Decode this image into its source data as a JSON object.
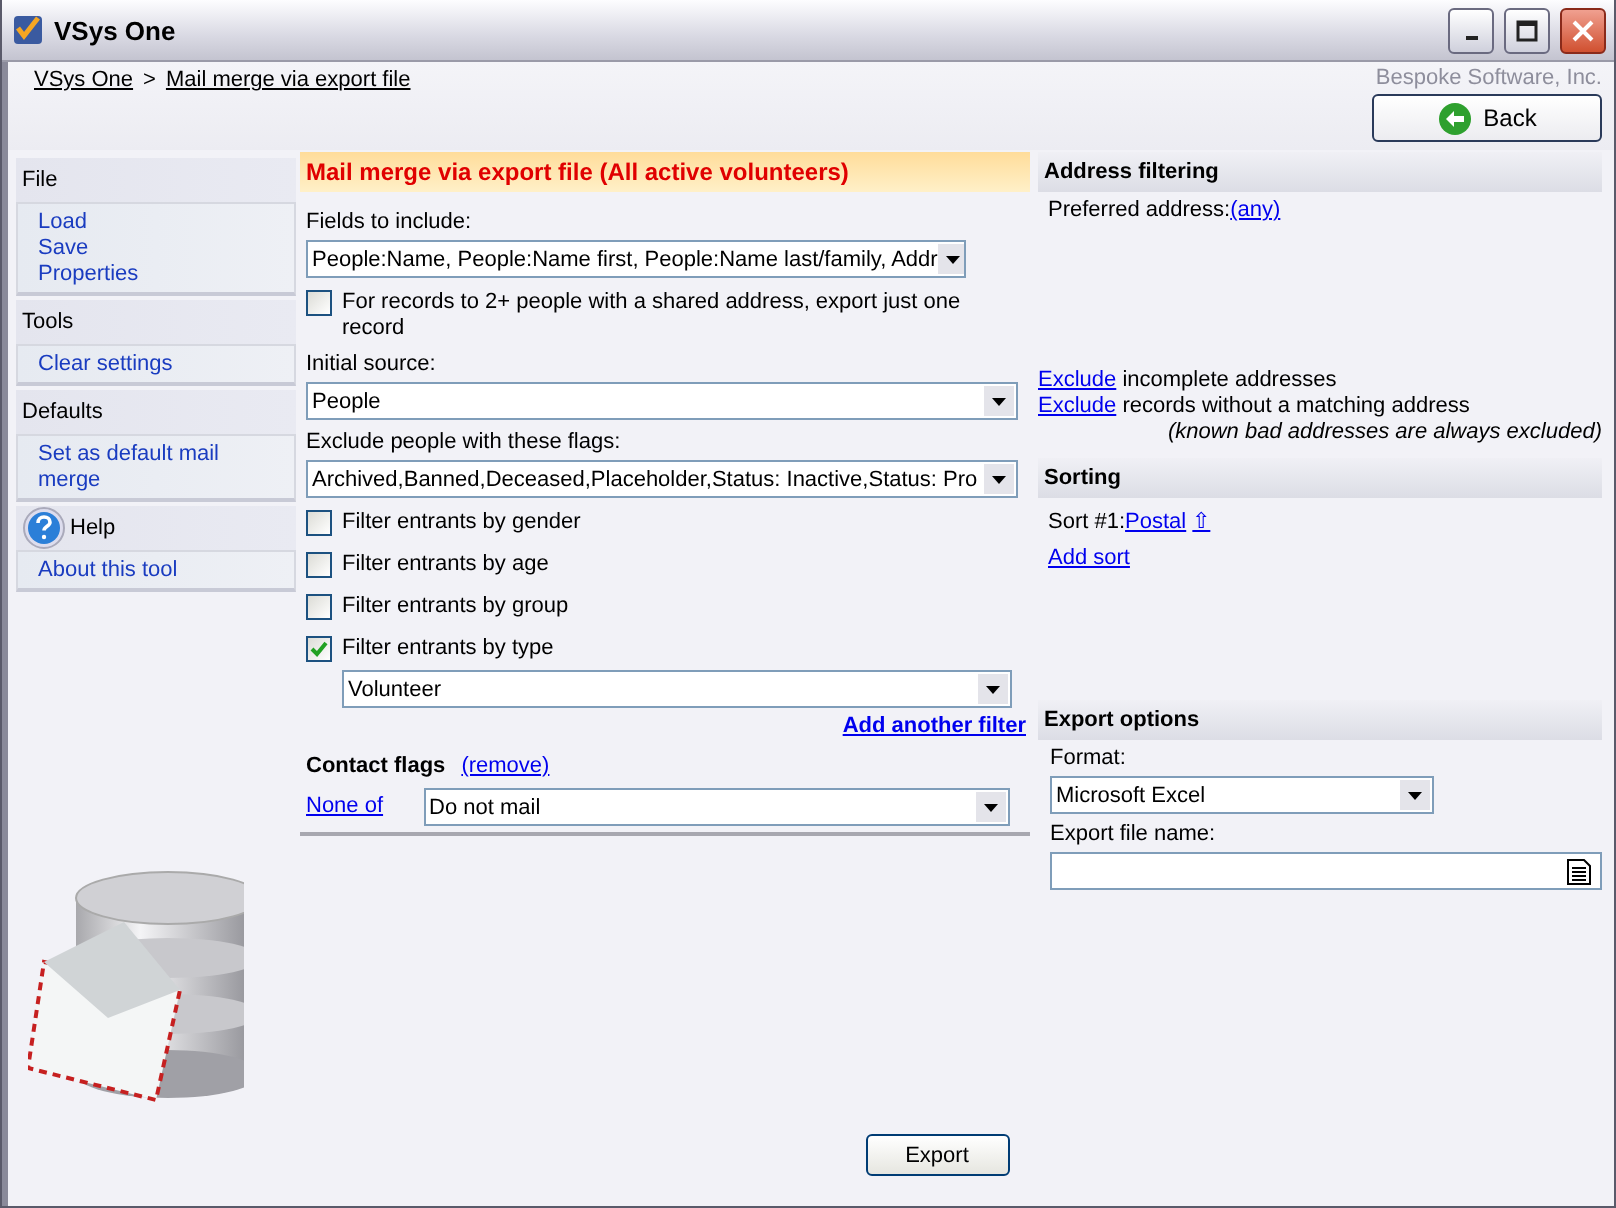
{
  "window": {
    "title": "VSys One"
  },
  "breadcrumb": {
    "items": [
      "VSys One",
      "Mail merge via export file"
    ],
    "separator": ">"
  },
  "company": "Bespoke Software, Inc.",
  "back_button": "Back",
  "sidebar": {
    "sections": [
      {
        "title": "File",
        "kind": "plain",
        "items": [
          "Load",
          "Save",
          "Properties"
        ]
      },
      {
        "title": "Tools",
        "kind": "plain",
        "items": [
          "Clear settings"
        ]
      },
      {
        "title": "Defaults",
        "kind": "plain",
        "items": [
          "Set as default mail merge"
        ]
      },
      {
        "title": "Help",
        "kind": "help",
        "items": [
          "About this tool"
        ]
      }
    ]
  },
  "main": {
    "title": "Mail merge via export file (All active volunteers)",
    "fields": {
      "label": "Fields to include:",
      "value": "People:Name, People:Name first, People:Name last/family, Addr"
    },
    "shared_address": {
      "label": "For records to 2+ people with a shared address, export just one record",
      "checked": false
    },
    "initial_source": {
      "label": "Initial source:",
      "value": "People"
    },
    "exclude_flags": {
      "label": "Exclude people with these flags:",
      "value": "Archived,Banned,Deceased,Placeholder,Status: Inactive,Status: Pro"
    },
    "filters": [
      {
        "label": "Filter entrants by gender",
        "checked": false
      },
      {
        "label": "Filter entrants by age",
        "checked": false
      },
      {
        "label": "Filter entrants by group",
        "checked": false
      },
      {
        "label": "Filter entrants by type",
        "checked": true,
        "value": "Volunteer"
      }
    ],
    "add_filter": "Add another filter",
    "contact_flags": {
      "title": "Contact flags",
      "remove": "(remove)",
      "condition": "None of",
      "value": "Do not mail"
    }
  },
  "address_filtering": {
    "title": "Address filtering",
    "preferred_label": "Preferred address:",
    "preferred_value": "(any)",
    "rules": [
      {
        "link": "Exclude",
        "text": "incomplete addresses"
      },
      {
        "link": "Exclude",
        "text": "records without a matching address"
      }
    ],
    "note": "(known bad addresses are always excluded)"
  },
  "sorting": {
    "title": "Sorting",
    "sorts": [
      {
        "label": "Sort #1:",
        "field": "Postal",
        "direction": "⇧"
      }
    ],
    "add": "Add sort"
  },
  "export_options": {
    "title": "Export options",
    "format_label": "Format:",
    "format_value": "Microsoft Excel",
    "file_label": "Export file name:"
  },
  "export_button": "Export"
}
